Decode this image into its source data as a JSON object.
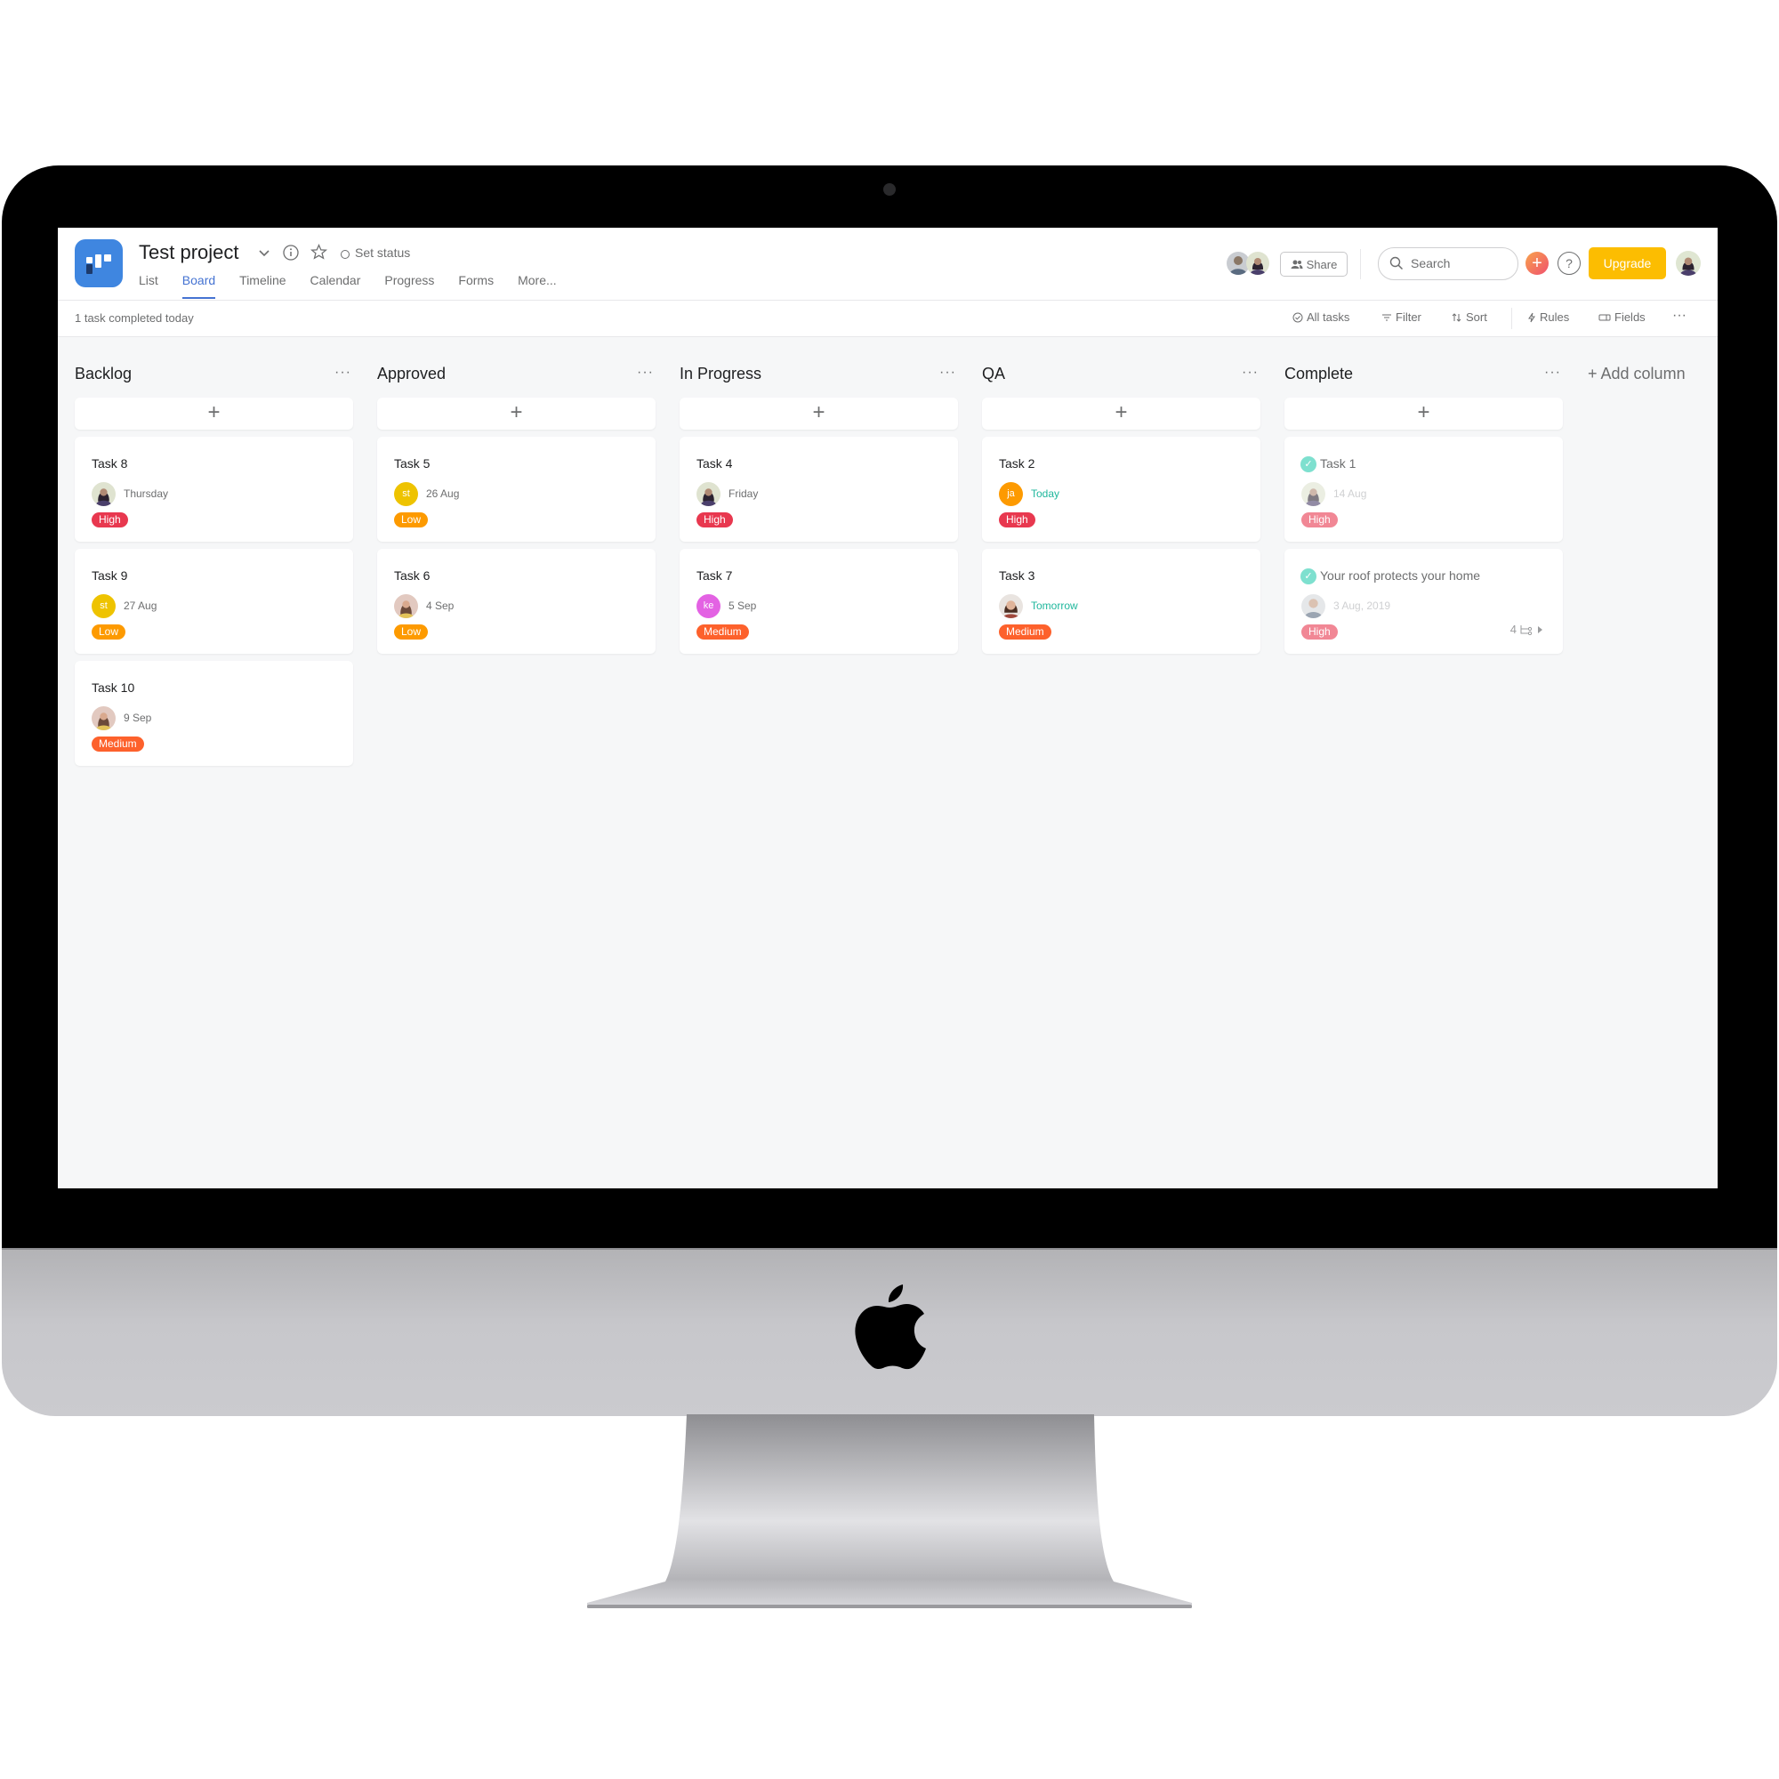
{
  "project": {
    "title": "Test project",
    "set_status": "Set status"
  },
  "tabs": [
    {
      "label": "List",
      "active": false
    },
    {
      "label": "Board",
      "active": true
    },
    {
      "label": "Timeline",
      "active": false
    },
    {
      "label": "Calendar",
      "active": false
    },
    {
      "label": "Progress",
      "active": false
    },
    {
      "label": "Forms",
      "active": false
    },
    {
      "label": "More...",
      "active": false
    }
  ],
  "header_right": {
    "share_label": "Share",
    "search_placeholder": "Search",
    "upgrade_label": "Upgrade",
    "help_label": "?",
    "add_label": "+"
  },
  "subbar": {
    "status_text": "1 task completed today",
    "all_tasks": "All tasks",
    "filter": "Filter",
    "sort": "Sort",
    "rules": "Rules",
    "fields": "Fields",
    "more": "···"
  },
  "colors": {
    "accent": "#4573d2",
    "upgrade": "#fcbd01",
    "logo": "#3f86e0",
    "high": "#e8384f",
    "low": "#fd9a00",
    "medium": "#fd612c",
    "due_green": "#1fb79c"
  },
  "board": {
    "add_column_label": "+ Add column",
    "more_label": "···",
    "add_card_label": "+",
    "columns": [
      {
        "name": "Backlog",
        "cards": [
          {
            "title": "Task 8",
            "avatar": "photo-woman-dark",
            "date": "Thursday",
            "priority": "High"
          },
          {
            "title": "Task 9",
            "avatar_initials": "st",
            "avatar_color": "#eec300",
            "date": "27 Aug",
            "priority": "Low"
          },
          {
            "title": "Task 10",
            "avatar": "photo-woman-light",
            "date": "9 Sep",
            "priority": "Medium"
          }
        ]
      },
      {
        "name": "Approved",
        "cards": [
          {
            "title": "Task 5",
            "avatar_initials": "st",
            "avatar_color": "#eec300",
            "date": "26 Aug",
            "priority": "Low"
          },
          {
            "title": "Task 6",
            "avatar": "photo-woman-light",
            "date": "4 Sep",
            "priority": "Low"
          }
        ]
      },
      {
        "name": "In Progress",
        "cards": [
          {
            "title": "Task 4",
            "avatar": "photo-woman-dark",
            "date": "Friday",
            "priority": "High"
          },
          {
            "title": "Task 7",
            "avatar_initials": "ke",
            "avatar_color": "#e362e3",
            "date": "5 Sep",
            "priority": "Medium"
          }
        ]
      },
      {
        "name": "QA",
        "cards": [
          {
            "title": "Task 2",
            "avatar_initials": "ja",
            "avatar_color": "#fd9a00",
            "date": "Today",
            "date_style": "green",
            "priority": "High"
          },
          {
            "title": "Task 3",
            "avatar": "photo-woman-smile",
            "date": "Tomorrow",
            "date_style": "green",
            "priority": "Medium"
          }
        ]
      },
      {
        "name": "Complete",
        "cards": [
          {
            "title": "Task 1",
            "completed": true,
            "avatar": "photo-woman-dark",
            "date": "14 Aug",
            "date_style": "faded",
            "priority": "High"
          },
          {
            "title": "Your roof protects your home",
            "completed": true,
            "avatar": "photo-man",
            "date": "3 Aug, 2019",
            "date_style": "faded",
            "priority": "High",
            "subtask_count": "4"
          }
        ]
      }
    ]
  }
}
